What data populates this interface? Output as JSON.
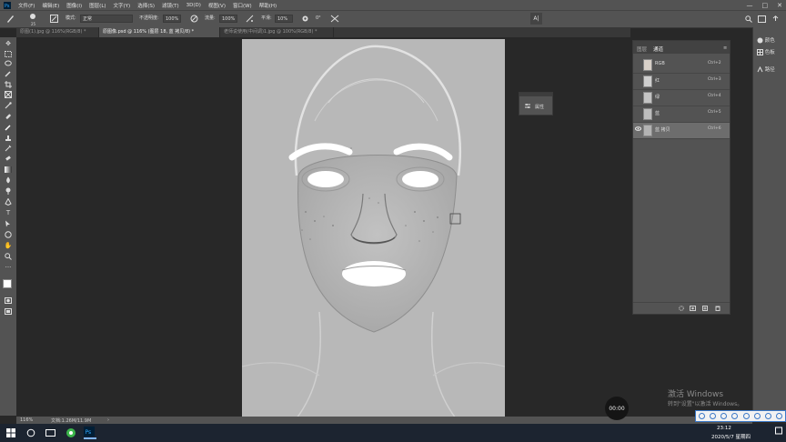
{
  "menu": {
    "items": [
      "文件(F)",
      "编辑(E)",
      "图像(I)",
      "图层(L)",
      "文字(Y)",
      "选择(S)",
      "滤镜(T)",
      "3D(D)",
      "视图(V)",
      "窗口(W)",
      "帮助(H)"
    ]
  },
  "window_controls": {
    "minimize": "—",
    "maximize": "□",
    "close": "✕"
  },
  "options": {
    "brush_size": "25",
    "mode_label": "模式:",
    "mode_value": "正常",
    "opacity_label": "不透明度:",
    "opacity_value": "100%",
    "flow_label": "流量:",
    "flow_value": "100%",
    "smooth_label": "平滑:",
    "smooth_value": "10%",
    "angle_value": "0°"
  },
  "tabs": [
    {
      "label": "原图(1).jpg @ 116%(RGB/8) *"
    },
    {
      "label": "原图像.psd @ 116% (图层 18, 蓝 拷贝/8) *"
    },
    {
      "label": "老师说使用(中间调)1.jpg @ 100%(RGB/8) *"
    }
  ],
  "properties_panel": {
    "title": "属性"
  },
  "channels": {
    "tab_layers": "图层",
    "tab_channels": "通道",
    "rows": [
      {
        "name": "RGB",
        "shortcut": "Ctrl+2"
      },
      {
        "name": "红",
        "shortcut": "Ctrl+3"
      },
      {
        "name": "绿",
        "shortcut": "Ctrl+4"
      },
      {
        "name": "蓝",
        "shortcut": "Ctrl+5"
      },
      {
        "name": "蓝 拷贝",
        "shortcut": "Ctrl+6"
      }
    ]
  },
  "dock": {
    "item1": "颜色",
    "item2": "色板",
    "item3": "路径"
  },
  "status": {
    "zoom": "116%",
    "doc": "文档:1.26M/11.9M"
  },
  "timer": {
    "value": "00:00"
  },
  "watermark": {
    "line1": "激活 Windows",
    "line2": "转到\"设置\"以激活 Windows。"
  },
  "clock": {
    "time": "23:12",
    "date": "2020/5/7 星期四"
  },
  "colors": {
    "panel": "#535353",
    "canvas": "#282828",
    "accent_tray": "#3a78c8"
  }
}
